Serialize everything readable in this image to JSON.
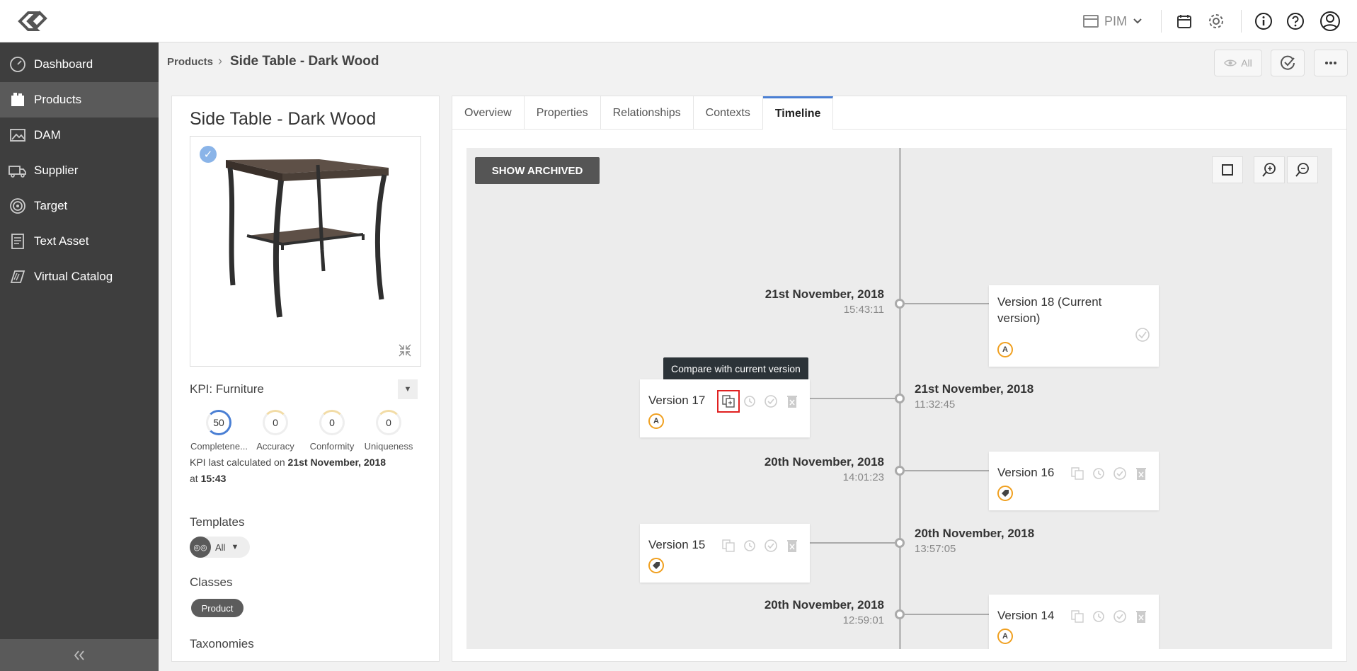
{
  "header": {
    "app_switcher": "PIM"
  },
  "sidebar": {
    "items": [
      {
        "label": "Dashboard",
        "icon": "gauge-icon"
      },
      {
        "label": "Products",
        "icon": "products-icon"
      },
      {
        "label": "DAM",
        "icon": "image-icon"
      },
      {
        "label": "Supplier",
        "icon": "truck-icon"
      },
      {
        "label": "Target",
        "icon": "target-icon"
      },
      {
        "label": "Text Asset",
        "icon": "document-icon"
      },
      {
        "label": "Virtual Catalog",
        "icon": "catalog-icon"
      }
    ],
    "active_index": 1
  },
  "breadcrumb": {
    "parent": "Products",
    "separator": "›",
    "current": "Side Table - Dark Wood"
  },
  "toolbar": {
    "visibility_label": "All"
  },
  "product": {
    "title": "Side Table - Dark Wood",
    "kpi": {
      "label": "KPI:",
      "value": "Furniture",
      "metrics": [
        {
          "value": "50",
          "label": "Completene...",
          "progress": 0.5
        },
        {
          "value": "0",
          "label": "Accuracy",
          "progress": 0
        },
        {
          "value": "0",
          "label": "Conformity",
          "progress": 0
        },
        {
          "value": "0",
          "label": "Uniqueness",
          "progress": 0
        }
      ],
      "calc_prefix": "KPI last calculated on",
      "calc_date": "21st November, 2018",
      "calc_at": "at",
      "calc_time": "15:43"
    },
    "templates": {
      "heading": "Templates",
      "value": "All"
    },
    "classes": {
      "heading": "Classes",
      "items": [
        "Product"
      ]
    },
    "taxonomies": {
      "heading": "Taxonomies"
    }
  },
  "tabs": [
    {
      "label": "Overview",
      "active": false
    },
    {
      "label": "Properties",
      "active": false
    },
    {
      "label": "Relationships",
      "active": false
    },
    {
      "label": "Contexts",
      "active": false
    },
    {
      "label": "Timeline",
      "active": true
    }
  ],
  "timeline": {
    "show_archived_label": "SHOW ARCHIVED",
    "tooltip": "Compare with current version",
    "entries": [
      {
        "version": "Version 18 (Current version)",
        "date": "21st November, 2018",
        "time": "15:43:11",
        "side": "right",
        "badge": "A"
      },
      {
        "version": "Version 17",
        "date": "21st November, 2018",
        "time": "11:32:45",
        "side": "left",
        "badge": "A"
      },
      {
        "version": "Version 16",
        "date": "20th November, 2018",
        "time": "14:01:23",
        "side": "right",
        "badge": "tag"
      },
      {
        "version": "Version 15",
        "date": "20th November, 2018",
        "time": "13:57:05",
        "side": "left",
        "badge": "tag"
      },
      {
        "version": "Version 14",
        "date": "20th November, 2018",
        "time": "12:59:01",
        "side": "right",
        "badge": "A"
      }
    ]
  },
  "colors": {
    "accent": "#4a7fd4",
    "sidebar_bg": "#3e3e3e",
    "highlight": "#e02020",
    "badge_ring": "#f0a020"
  }
}
